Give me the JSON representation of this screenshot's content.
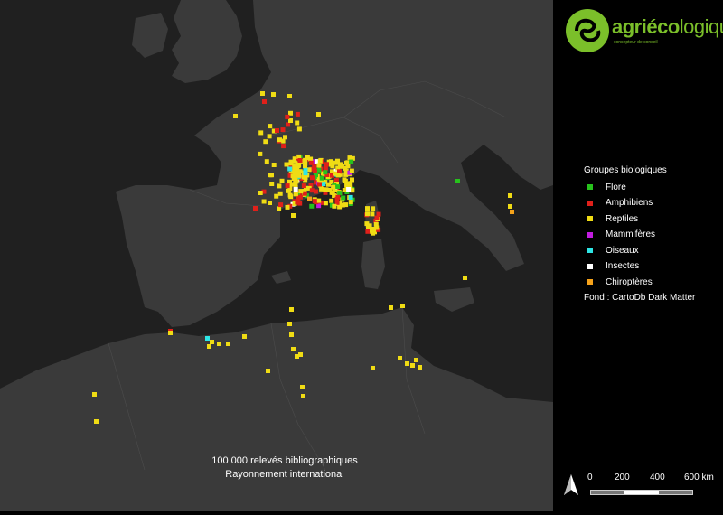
{
  "logo": {
    "text_bold": "agriéco",
    "text_light": "logique",
    "tagline": "concepteur de conseil"
  },
  "caption": {
    "line1": "100 000 relevés bibliographiques",
    "line2": "Rayonnement international"
  },
  "legend": {
    "title": "Groupes biologiques",
    "items": [
      {
        "label": "Flore",
        "color": "#27c21c"
      },
      {
        "label": "Amphibiens",
        "color": "#e0201a"
      },
      {
        "label": "Reptiles",
        "color": "#f0dc14"
      },
      {
        "label": "Mammifères",
        "color": "#c21ce0"
      },
      {
        "label": "Oiseaux",
        "color": "#2ee6e6"
      },
      {
        "label": "Insectes",
        "color": "#ffffff"
      },
      {
        "label": "Chiroptères",
        "color": "#f5a21a"
      }
    ]
  },
  "basemap_credit": "Fond : CartoDb Dark Matter",
  "scalebar": {
    "labels": [
      "0",
      "200",
      "400",
      "600 km"
    ]
  },
  "colors": {
    "land": "#3a3a3a",
    "sea": "#202020",
    "panel": "#000000",
    "brand": "#7bbf2a"
  }
}
